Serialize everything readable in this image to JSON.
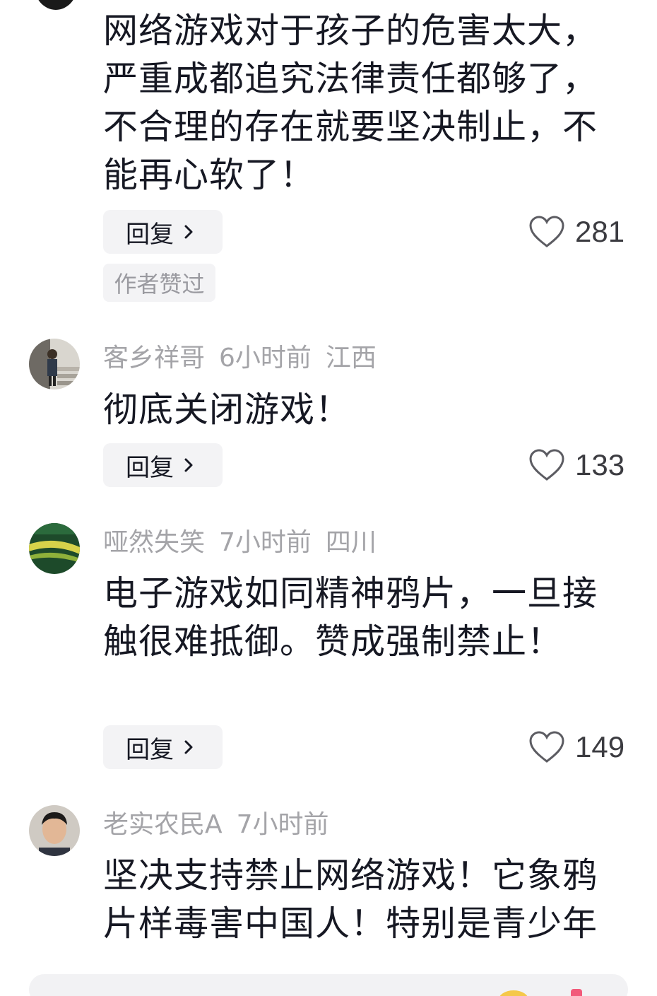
{
  "comments": [
    {
      "text": "网络游戏对于孩子的危害太大，严重成都追究法律责任都够了，不合理的存在就要坚决制止，不能再心软了！",
      "reply_label": "回复",
      "likes": "281",
      "badge": "作者赞过"
    },
    {
      "username": "客乡祥哥",
      "time": "6小时前",
      "location": "江西",
      "text": "彻底关闭游戏！",
      "reply_label": "回复",
      "likes": "133"
    },
    {
      "username": "哑然失笑",
      "time": "7小时前",
      "location": "四川",
      "text": "电子游戏如同精神鸦片，一旦接触很难抵御。赞成强制禁止！",
      "reply_label": "回复",
      "likes": "149"
    },
    {
      "username": "老实农民A",
      "time": "7小时前",
      "text": "坚决支持禁止网络游戏！它象鸦片样毒害中国人！特别是青少年"
    }
  ],
  "icons": {
    "like": "heart-outline-icon",
    "reply_arrow": "chevron-right-icon"
  },
  "colors": {
    "meta_gray": "#a4a4a8",
    "text": "#161823",
    "button_bg": "#f3f3f5"
  }
}
